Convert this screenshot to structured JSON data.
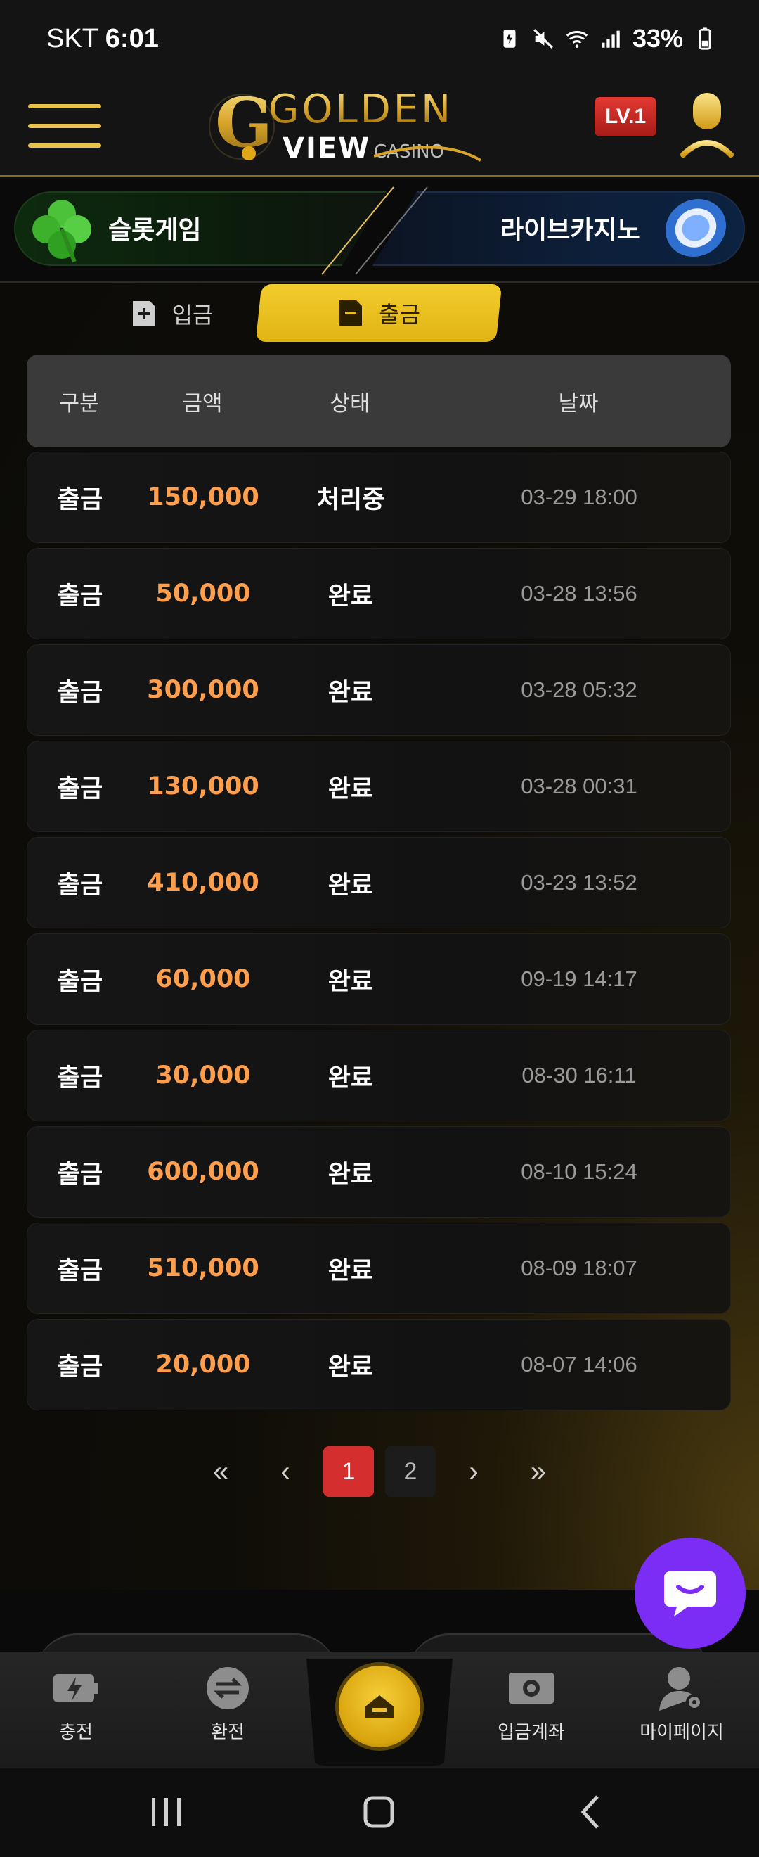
{
  "status_bar": {
    "carrier": "SKT",
    "time": "6:01",
    "battery": "33%"
  },
  "header": {
    "logo_main": "GOLDEN",
    "logo_sub": "VIEW",
    "logo_tag": "CASINO",
    "level_badge": "LV.1"
  },
  "banners": {
    "slot_label": "슬롯게임",
    "live_label": "라이브카지노"
  },
  "tabs": {
    "deposit": "입금",
    "withdraw": "출금"
  },
  "table": {
    "headers": [
      "구분",
      "금액",
      "상태",
      "날짜"
    ],
    "rows": [
      {
        "type": "출금",
        "amount": "150,000",
        "status": "처리중",
        "date": "03-29 18:00"
      },
      {
        "type": "출금",
        "amount": "50,000",
        "status": "완료",
        "date": "03-28 13:56"
      },
      {
        "type": "출금",
        "amount": "300,000",
        "status": "완료",
        "date": "03-28 05:32"
      },
      {
        "type": "출금",
        "amount": "130,000",
        "status": "완료",
        "date": "03-28 00:31"
      },
      {
        "type": "출금",
        "amount": "410,000",
        "status": "완료",
        "date": "03-23 13:52"
      },
      {
        "type": "출금",
        "amount": "60,000",
        "status": "완료",
        "date": "09-19 14:17"
      },
      {
        "type": "출금",
        "amount": "30,000",
        "status": "완료",
        "date": "08-30 16:11"
      },
      {
        "type": "출금",
        "amount": "600,000",
        "status": "완료",
        "date": "08-10 15:24"
      },
      {
        "type": "출금",
        "amount": "510,000",
        "status": "완료",
        "date": "08-09 18:07"
      },
      {
        "type": "출금",
        "amount": "20,000",
        "status": "완료",
        "date": "08-07 14:06"
      }
    ]
  },
  "pagination": {
    "first": "«",
    "prev": "‹",
    "pages": [
      "1",
      "2"
    ],
    "current": "1",
    "next": "›",
    "last": "»"
  },
  "bottom_nav": {
    "charge": "충전",
    "exchange": "환전",
    "deposit_account": "입금계좌",
    "mypage": "마이페이지"
  },
  "colors": {
    "accent_gold": "#f3cc2d",
    "amount_orange": "#ff9f4d",
    "active_page_red": "#d52e2e",
    "chat_purple": "#7b2cf5"
  },
  "icons": [
    "menu-icon",
    "user-icon",
    "clover-icon",
    "chip-icon",
    "plus-doc-icon",
    "minus-doc-icon",
    "chat-icon",
    "charge-icon",
    "exchange-icon",
    "home-icon",
    "bank-icon",
    "mypage-icon"
  ]
}
